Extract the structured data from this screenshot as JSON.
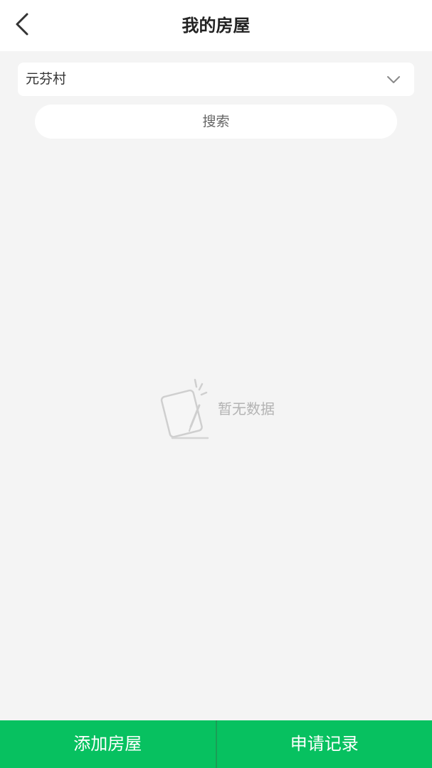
{
  "header": {
    "title": "我的房屋",
    "back_icon": "chevron-left-icon"
  },
  "filter": {
    "village": "元芬村",
    "dropdown_icon": "chevron-down-icon"
  },
  "search": {
    "label": "搜索"
  },
  "empty_state": {
    "icon": "empty-notepad-icon",
    "text": "暂无数据"
  },
  "footer": {
    "add_house_label": "添加房屋",
    "records_label": "申请记录"
  },
  "colors": {
    "accent": "#07c160",
    "background": "#f4f4f4",
    "empty_text": "#b3b3b3"
  }
}
